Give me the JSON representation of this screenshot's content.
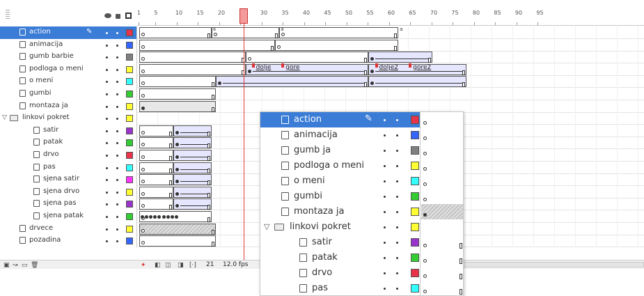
{
  "timeline": {
    "ruler_ticks": [
      "1",
      "5",
      "10",
      "15",
      "20",
      "25",
      "30",
      "35",
      "40",
      "45",
      "50",
      "55",
      "60",
      "65",
      "70",
      "75",
      "80",
      "85",
      "90",
      "95"
    ],
    "current_frame": "21",
    "fps": "12.0 fps",
    "layers": [
      {
        "name": "action",
        "type": "layer",
        "indent": 0,
        "selected": true,
        "color": "#e8334a"
      },
      {
        "name": "animacija",
        "type": "layer",
        "indent": 0,
        "color": "#3366ff"
      },
      {
        "name": "gumb barbie",
        "type": "layer",
        "indent": 0,
        "color": "#808080"
      },
      {
        "name": "podloga o meni",
        "type": "layer",
        "indent": 0,
        "color": "#ffff33"
      },
      {
        "name": "o meni",
        "type": "layer",
        "indent": 0,
        "color": "#33ffff"
      },
      {
        "name": "gumbi",
        "type": "layer",
        "indent": 0,
        "color": "#33cc33"
      },
      {
        "name": "montaza ja",
        "type": "layer",
        "indent": 0,
        "color": "#ffff33"
      },
      {
        "name": "linkovi pokret",
        "type": "folder",
        "indent": 0,
        "color": "#ffff33"
      },
      {
        "name": "satir",
        "type": "layer",
        "indent": 1,
        "color": "#9933cc"
      },
      {
        "name": "patak",
        "type": "layer",
        "indent": 1,
        "color": "#33cc33"
      },
      {
        "name": "drvo",
        "type": "layer",
        "indent": 1,
        "color": "#e8334a"
      },
      {
        "name": "pas",
        "type": "layer",
        "indent": 1,
        "color": "#33ffff"
      },
      {
        "name": "sjena satir",
        "type": "layer",
        "indent": 1,
        "color": "#ff33ff"
      },
      {
        "name": "sjena drvo",
        "type": "layer",
        "indent": 1,
        "color": "#ffff33"
      },
      {
        "name": "sjena pas",
        "type": "layer",
        "indent": 1,
        "color": "#9933cc"
      },
      {
        "name": "sjena patak",
        "type": "layer",
        "indent": 1,
        "color": "#33cc33"
      },
      {
        "name": "drvece",
        "type": "layer",
        "indent": 0,
        "color": "#ffff33"
      },
      {
        "name": "pozadina",
        "type": "layer",
        "indent": 0,
        "color": "#3366ff"
      }
    ],
    "frame_labels": [
      "dolje",
      "gore",
      "dolje2",
      "gore2"
    ]
  },
  "zoom": {
    "layers": [
      {
        "name": "action",
        "type": "layer",
        "indent": 0,
        "selected": true,
        "color": "#e8334a"
      },
      {
        "name": "animacija",
        "type": "layer",
        "indent": 0,
        "color": "#3366ff"
      },
      {
        "name": "gumb ja",
        "type": "layer",
        "indent": 0,
        "color": "#808080"
      },
      {
        "name": "podloga o meni",
        "type": "layer",
        "indent": 0,
        "color": "#ffff33"
      },
      {
        "name": "o meni",
        "type": "layer",
        "indent": 0,
        "color": "#33ffff"
      },
      {
        "name": "gumbi",
        "type": "layer",
        "indent": 0,
        "color": "#33cc33"
      },
      {
        "name": "montaza ja",
        "type": "layer",
        "indent": 0,
        "color": "#ffff33"
      },
      {
        "name": "linkovi pokret",
        "type": "folder",
        "indent": 0,
        "color": "#ffff33"
      },
      {
        "name": "satir",
        "type": "layer",
        "indent": 1,
        "color": "#9933cc"
      },
      {
        "name": "patak",
        "type": "layer",
        "indent": 1,
        "color": "#33cc33"
      },
      {
        "name": "drvo",
        "type": "layer",
        "indent": 1,
        "color": "#e8334a"
      },
      {
        "name": "pas",
        "type": "layer",
        "indent": 1,
        "color": "#33ffff"
      }
    ]
  }
}
